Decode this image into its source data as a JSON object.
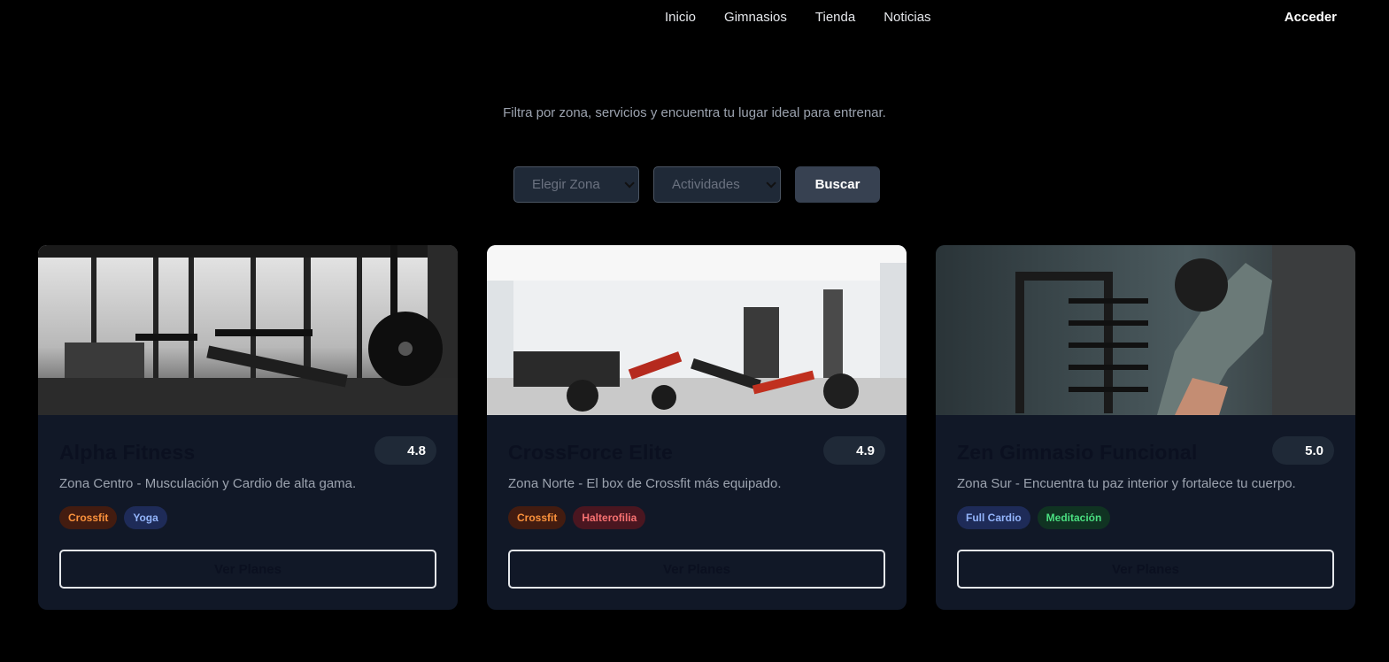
{
  "nav": {
    "links": [
      "Inicio",
      "Gimnasios",
      "Tienda",
      "Noticias"
    ],
    "login": "Acceder"
  },
  "hero": {
    "subtitle": "Filtra por zona, servicios y encuentra tu lugar ideal para entrenar."
  },
  "filters": {
    "zona": "Elegir Zona",
    "actividades": "Actividades",
    "search": "Buscar"
  },
  "gyms": [
    {
      "name": "Alpha Fitness",
      "rating": "4.8",
      "description": "Zona Centro - Musculación y Cardio de alta gama.",
      "tags": [
        "Crossfit",
        "Yoga"
      ],
      "cta": "Ver Planes"
    },
    {
      "name": "CrossForce Elite",
      "rating": "4.9",
      "description": "Zona Norte - El box de Crossfit más equipado.",
      "tags": [
        "Crossfit",
        "Halterofilia"
      ],
      "cta": "Ver Planes"
    },
    {
      "name": "Zen Gimnasio Funcional",
      "rating": "5.0",
      "description": "Zona Sur - Encuentra tu paz interior y fortalece tu cuerpo.",
      "tags": [
        "Full Cardio",
        "Meditación"
      ],
      "cta": "Ver Planes"
    }
  ],
  "colors": {
    "background": "#000000",
    "card": "#111827",
    "pill": "#1f2937",
    "button": "#374151"
  }
}
